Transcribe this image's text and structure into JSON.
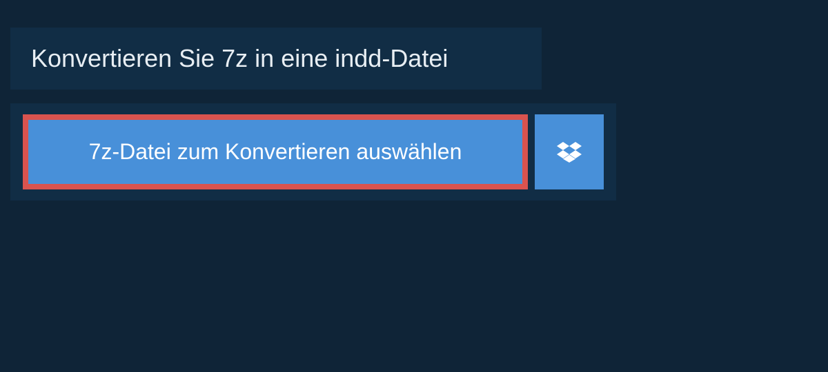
{
  "header": {
    "title": "Konvertieren Sie 7z in eine indd-Datei"
  },
  "actions": {
    "select_file_label": "7z-Datei zum Konvertieren auswählen"
  },
  "colors": {
    "background": "#0f2437",
    "panel": "#112d45",
    "button": "#4890d9",
    "highlight_border": "#d9534f"
  }
}
